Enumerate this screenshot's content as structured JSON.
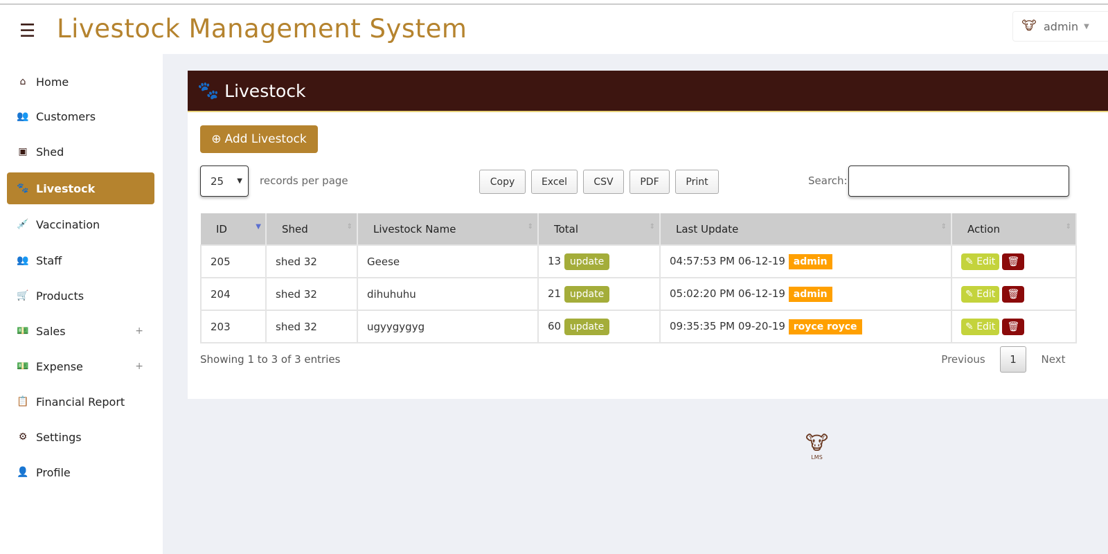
{
  "header": {
    "title": "Livestock Management System",
    "user": "admin"
  },
  "sidebar": {
    "items": [
      {
        "label": "Home",
        "icon": "home-icon",
        "glyph": "⌂"
      },
      {
        "label": "Customers",
        "icon": "users-icon",
        "glyph": "👥"
      },
      {
        "label": "Shed",
        "icon": "archive-icon",
        "glyph": "▣"
      },
      {
        "label": "Livestock",
        "icon": "paw-icon",
        "glyph": "🐾",
        "active": true
      },
      {
        "label": "Vaccination",
        "icon": "syringe-icon",
        "glyph": "💉"
      },
      {
        "label": "Staff",
        "icon": "users-icon",
        "glyph": "👥"
      },
      {
        "label": "Products",
        "icon": "cart-icon",
        "glyph": "🛒"
      },
      {
        "label": "Sales",
        "icon": "money-icon",
        "glyph": "💵",
        "expand": "+"
      },
      {
        "label": "Expense",
        "icon": "money-icon",
        "glyph": "💵",
        "expand": "+"
      },
      {
        "label": "Financial Report",
        "icon": "clipboard-icon",
        "glyph": "📋"
      },
      {
        "label": "Settings",
        "icon": "gears-icon",
        "glyph": "⚙"
      },
      {
        "label": "Profile",
        "icon": "user-icon",
        "glyph": "👤"
      }
    ]
  },
  "panel": {
    "title": "Livestock",
    "add_label": "Add Livestock",
    "page_size": "25",
    "records_label": "records per page",
    "export": [
      "Copy",
      "Excel",
      "CSV",
      "PDF",
      "Print"
    ],
    "search_label": "Search:",
    "search_value": ""
  },
  "table": {
    "columns": [
      "ID",
      "Shed",
      "Livestock Name",
      "Total",
      "Last Update",
      "Action"
    ],
    "rows": [
      {
        "id": "205",
        "shed": "shed 32",
        "name": "Geese",
        "total": "13",
        "update": "update",
        "time": "04:57:53 PM 06-12-19",
        "by": "admin",
        "edit": "Edit"
      },
      {
        "id": "204",
        "shed": "shed 32",
        "name": "dihuhuhu",
        "total": "21",
        "update": "update",
        "time": "05:02:20 PM 06-12-19",
        "by": "admin",
        "edit": "Edit"
      },
      {
        "id": "203",
        "shed": "shed 32",
        "name": "ugyygygyg",
        "total": "60",
        "update": "update",
        "time": "09:35:35 PM 09-20-19",
        "by": "royce royce",
        "edit": "Edit"
      }
    ]
  },
  "footer": {
    "info": "Showing 1 to 3 of 3 entries",
    "prev": "Previous",
    "page": "1",
    "next": "Next",
    "logo_text": "LMS"
  },
  "colors": {
    "brand": "#b5832e",
    "panel_header": "#3d1510"
  }
}
